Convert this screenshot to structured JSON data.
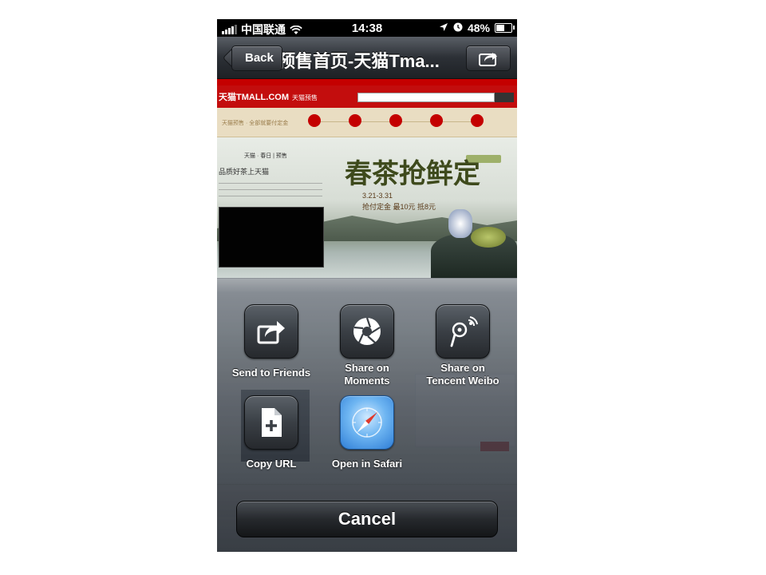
{
  "status_bar": {
    "carrier": "中国联通",
    "time": "14:38",
    "battery_percent": "48%",
    "battery_level": 0.48,
    "icons": [
      "signal-icon",
      "wifi-icon",
      "location-arrow-icon",
      "alarm-clock-icon",
      "battery-icon"
    ]
  },
  "nav": {
    "back_label": "Back",
    "title": "预售首页-天猫Tma...",
    "share_icon": "share-icon"
  },
  "webpage": {
    "logo_text": "天猫TMALL.COM",
    "logo_sub": "天猫预售",
    "steps_label": "天猫预售 · 全部就要付定金",
    "banner_title": "春茶抢鲜定",
    "banner_dates": "3.21-3.31",
    "banner_offer": "抢付定金 最10元 抵8元",
    "text_head": "天猫 · 春日 | 预售",
    "text_h2": "品质好茶上天猫"
  },
  "action_sheet": {
    "actions": [
      {
        "label": "Send to Friends",
        "icon": "send-to-friends-icon"
      },
      {
        "label": "Share on Moments",
        "icon": "moments-camera-aperture-icon"
      },
      {
        "label": "Share on Tencent Weibo",
        "icon": "tencent-weibo-icon"
      },
      {
        "label": "Copy URL",
        "icon": "copy-url-icon"
      },
      {
        "label": "Open in Safari",
        "icon": "safari-compass-icon"
      }
    ],
    "cancel_label": "Cancel"
  },
  "colors": {
    "tmall_red": "#c40000",
    "sheet_dark": "#2a3038",
    "safari_blue": "#2f7ed6"
  }
}
